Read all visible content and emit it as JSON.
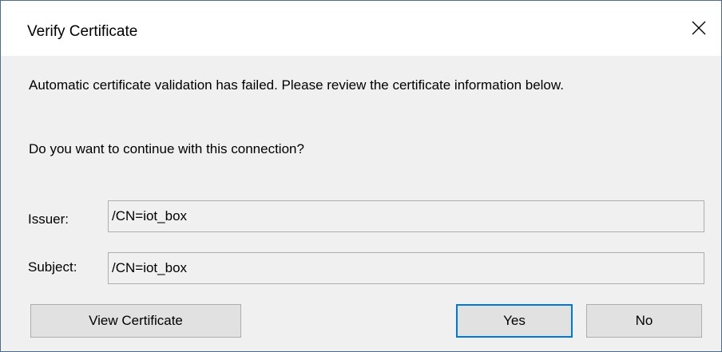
{
  "window": {
    "title": "Verify Certificate",
    "close_glyph": "close-icon"
  },
  "message": {
    "line1": "Automatic certificate validation has failed. Please review the certificate information below.",
    "line2": "Do you want to continue with this connection?"
  },
  "fields": {
    "issuer_label": "Issuer:",
    "issuer_value": "/CN=iot_box",
    "subject_label": "Subject:",
    "subject_value": "/CN=iot_box"
  },
  "buttons": {
    "view_certificate": "View Certificate",
    "yes": "Yes",
    "no": "No"
  },
  "colors": {
    "focus_accent": "#0078d7",
    "window_border": "#4f6b8a"
  }
}
